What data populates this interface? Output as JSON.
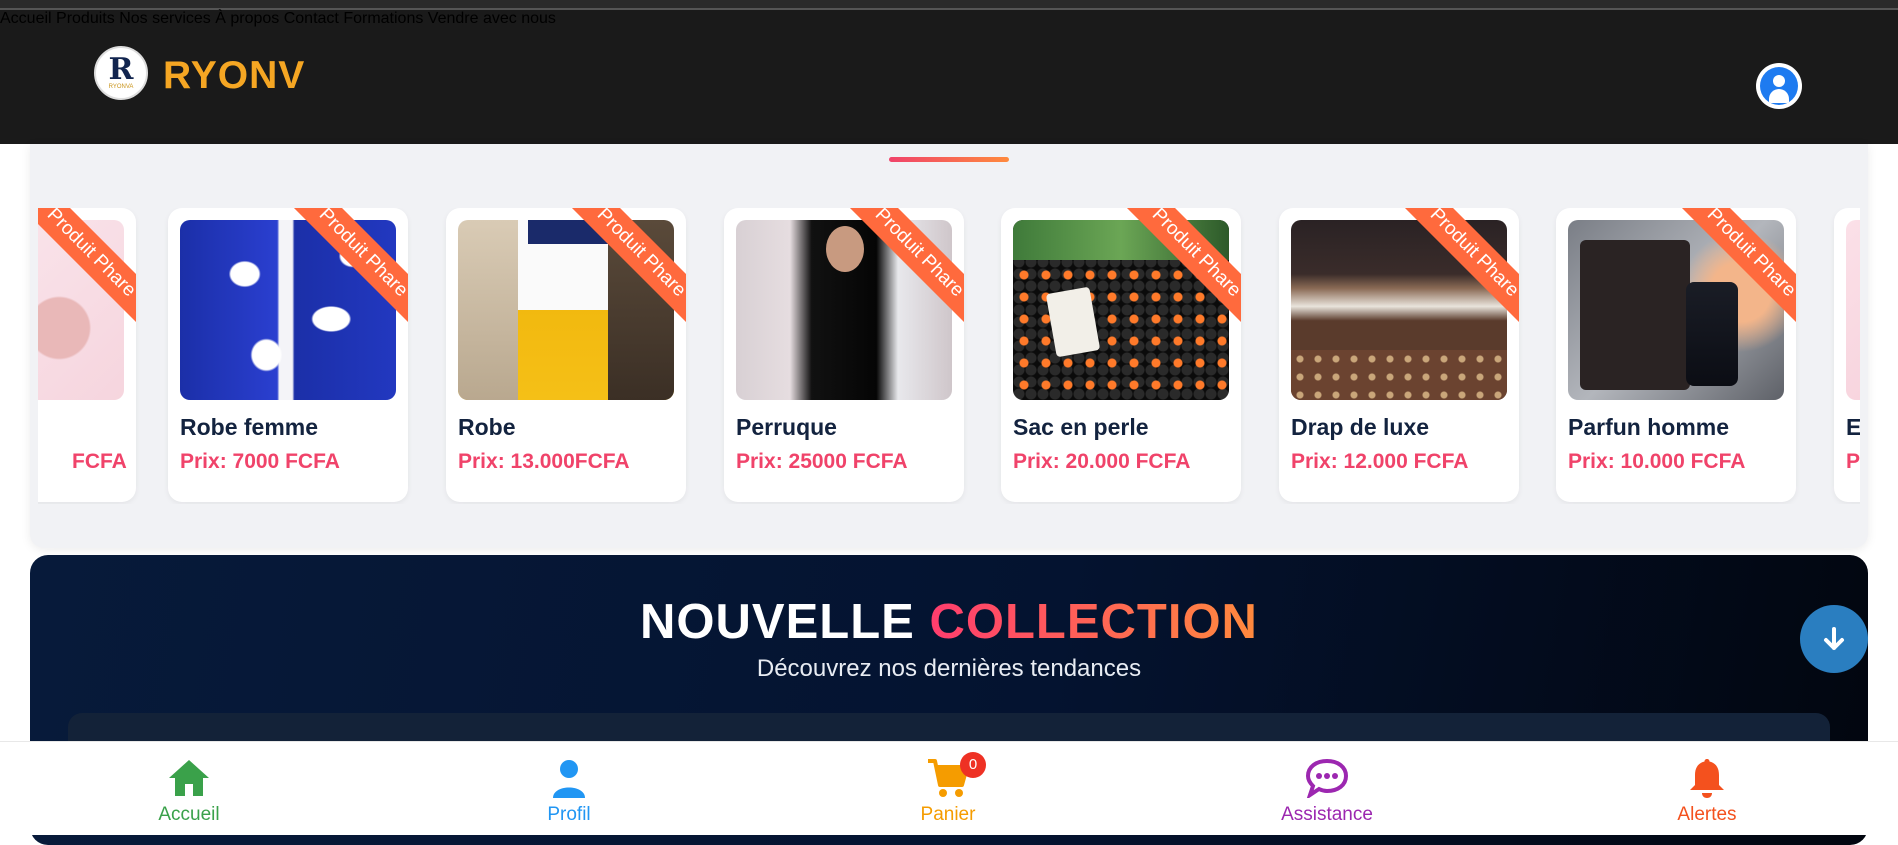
{
  "header": {
    "brand": "RYONV",
    "logo_letter": "R",
    "logo_text": "RYONVA",
    "nav": [
      "Accueil",
      "Produits",
      "Nos services",
      "À propos",
      "Contact",
      "Formations",
      "Vendre avec nous"
    ],
    "user_icon": "user-circle-icon"
  },
  "carousel": {
    "ribbon_label": "Produit Phare",
    "cards": [
      {
        "name": "",
        "price": "FCFA",
        "image": "pink-product"
      },
      {
        "name": "Robe femme",
        "price": "Prix: 7000 FCFA",
        "image": "blue-floral-dress"
      },
      {
        "name": "Robe",
        "price": "Prix: 13.000FCFA",
        "image": "white-yellow-dress"
      },
      {
        "name": "Perruque",
        "price": "Prix: 25000 FCFA",
        "image": "long-black-wig"
      },
      {
        "name": "Sac en perle",
        "price": "Prix: 20.000 FCFA",
        "image": "black-bead-bag"
      },
      {
        "name": "Drap de luxe",
        "price": "Prix: 12.000 FCFA",
        "image": "brown-luxury-bedsheet"
      },
      {
        "name": "Parfun homme",
        "price": "Prix: 10.000 FCFA",
        "image": "men-perfume-bottle"
      },
      {
        "name": "E",
        "price": "P",
        "image": "partial-product"
      }
    ]
  },
  "collection": {
    "title_white": "NOUVELLE",
    "title_color": "COLLECTION",
    "subtitle": "Découvrez nos dernières tendances"
  },
  "scroll_icon": "arrow-down-icon",
  "bottom_nav": {
    "cart_count": "0",
    "items": [
      {
        "label": "Accueil",
        "icon": "home-icon",
        "color": "#3aa14a"
      },
      {
        "label": "Profil",
        "icon": "user-icon",
        "color": "#2196f3"
      },
      {
        "label": "Panier",
        "icon": "cart-icon",
        "color": "#f59c00"
      },
      {
        "label": "Assistance",
        "icon": "chat-icon",
        "color": "#9c27b0"
      },
      {
        "label": "Alertes",
        "icon": "bell-icon",
        "color": "#f4511e"
      }
    ]
  },
  "colors": {
    "brand": "#f5a623",
    "price": "#f0436a",
    "ribbon": "#ff6a3d",
    "header_bg": "#1a1a1a"
  }
}
